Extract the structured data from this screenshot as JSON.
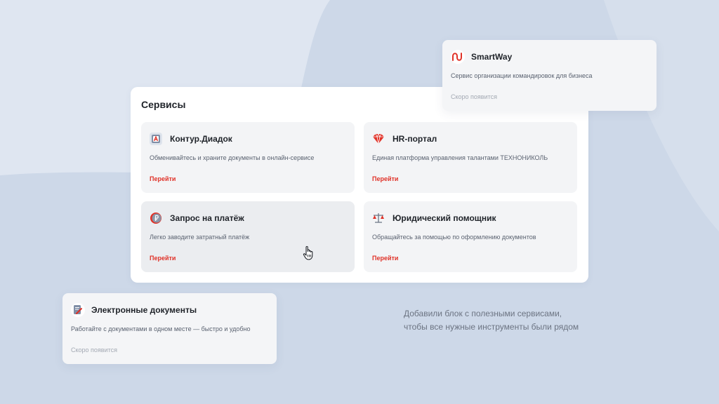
{
  "panel": {
    "title": "Сервисы"
  },
  "cards": [
    {
      "title": "Контур.Диадок",
      "description": "Обменивайтесь и храните документы в онлайн-сервисе",
      "link": "Перейти",
      "icon": "kontur-diadoc-icon"
    },
    {
      "title": "HR-портал",
      "description": "Единая платформа управления талантами ТЕХНОНИКОЛЬ",
      "link": "Перейти",
      "icon": "diamond-icon"
    },
    {
      "title": "Запрос на платёж",
      "description": "Легко заводите затратный платёж",
      "link": "Перейти",
      "icon": "ruble-coin-icon"
    },
    {
      "title": "Юридический помощник",
      "description": "Обращайтесь за помощью по оформлению документов",
      "link": "Перейти",
      "icon": "scales-icon"
    }
  ],
  "smartway": {
    "title": "SmartWay",
    "description": "Сервис организации командировок для бизнеса",
    "status": "Скоро появится",
    "icon": "smartway-logo-icon"
  },
  "edocs": {
    "title": "Электронные документы",
    "description": "Работайте с документами в одном месте — быстро и удобно",
    "status": "Скоро появится",
    "icon": "document-edit-icon"
  },
  "caption": {
    "line1": "Добавили блок с полезными сервисами,",
    "line2": "чтобы все нужные инструменты были рядом"
  },
  "colors": {
    "accent": "#e03127",
    "background": "#dfe6f1",
    "blob": "#cdd8e8"
  }
}
